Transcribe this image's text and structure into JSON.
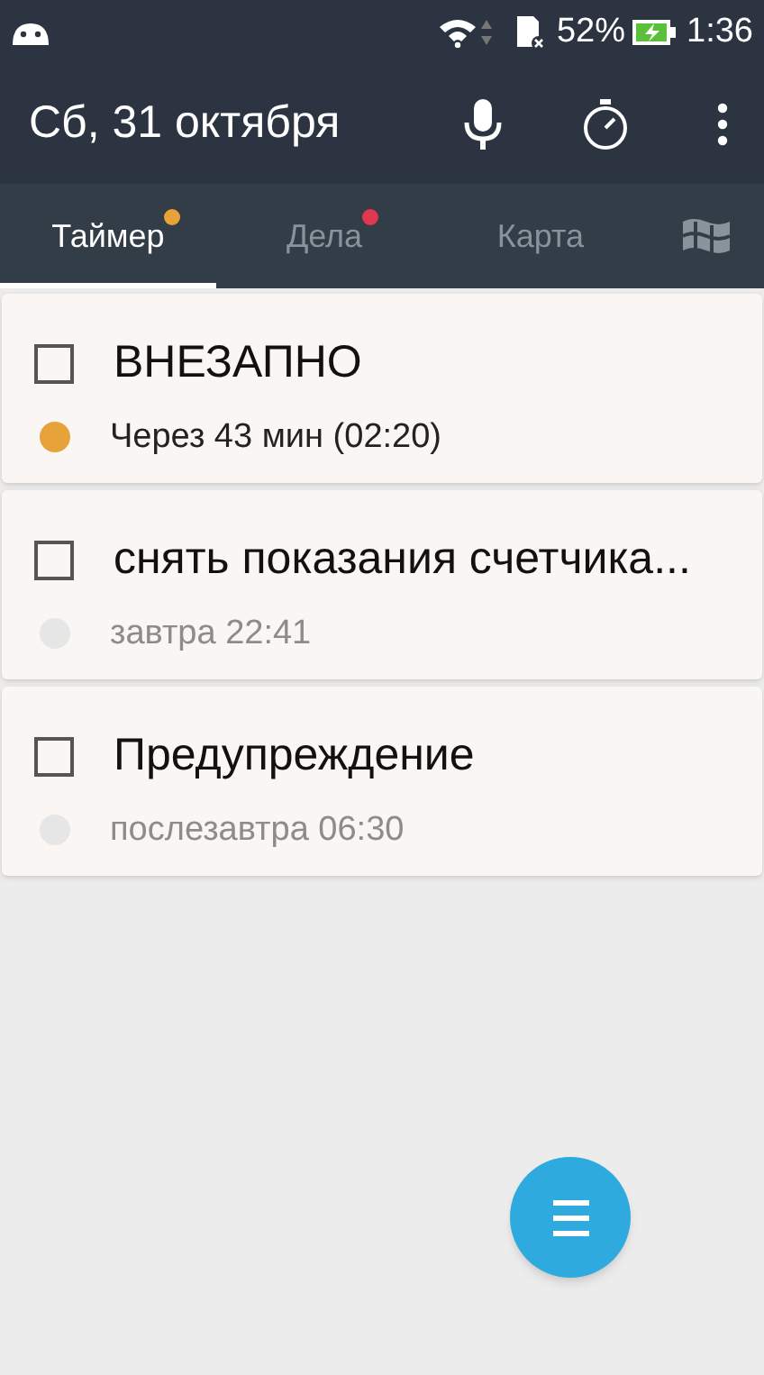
{
  "status_bar": {
    "battery": "52%",
    "time": "1:36"
  },
  "app_bar": {
    "title": "Сб, 31 октября"
  },
  "tabs": [
    {
      "kind": "text",
      "label": "Таймер",
      "selected": true,
      "color": "#e8a23a"
    },
    {
      "kind": "text",
      "label": "Дела",
      "selected": false,
      "color": "#e0394f"
    },
    {
      "kind": "text",
      "label": "Карта",
      "selected": false
    },
    {
      "kind": "icon",
      "selected": false
    }
  ],
  "tasks": [
    {
      "title": "ВНЕЗАПНО",
      "due": "Через 43 мин (02:20)",
      "checked": false,
      "color": "#e8a23a",
      "due_soon": true
    },
    {
      "title": "снять показания счетчика...",
      "due": "завтра 22:41",
      "checked": false,
      "color": "#e6e6e6",
      "due_soon": false
    },
    {
      "title": "Предупреждение",
      "due": "послезавтра 06:30",
      "checked": false,
      "color": "#e6e6e6",
      "due_soon": false
    }
  ]
}
